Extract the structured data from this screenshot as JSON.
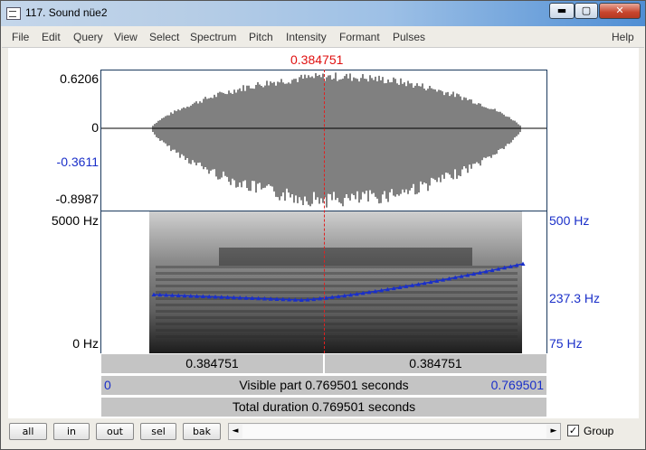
{
  "window": {
    "title": "117. Sound nüe2"
  },
  "window_buttons": {
    "minimize": "▬",
    "maximize": "▢",
    "close": "✕"
  },
  "menu": {
    "items": [
      "File",
      "Edit",
      "Query",
      "View",
      "Select",
      "Spectrum",
      "Pitch",
      "Intensity",
      "Formant",
      "Pulses"
    ],
    "help": "Help"
  },
  "cursor": {
    "time": "0.384751"
  },
  "waveform": {
    "y_max": "0.6206",
    "y_zero": "0",
    "y_local": "-0.3611",
    "y_min": "-0.8987"
  },
  "spectrogram": {
    "freq_top": "5000 Hz",
    "freq_bottom": "0 Hz"
  },
  "pitch": {
    "top": "500 Hz",
    "mid": "237.3 Hz",
    "bottom": "75 Hz"
  },
  "time_bars": {
    "left_segment": "0.384751",
    "right_segment": "0.384751",
    "visible_start": "0",
    "visible_label": "Visible part 0.769501 seconds",
    "visible_end": "0.769501",
    "total_label": "Total duration 0.769501 seconds"
  },
  "bottom": {
    "buttons": [
      "all",
      "in",
      "out",
      "sel",
      "bak"
    ],
    "group_label": "Group",
    "group_checked": true,
    "scroll_left": "◄",
    "scroll_right": "►"
  },
  "colors": {
    "cursor": "#e01010",
    "pitch": "#1a2fc9",
    "title_gradient_end": "#4f8ed4"
  }
}
